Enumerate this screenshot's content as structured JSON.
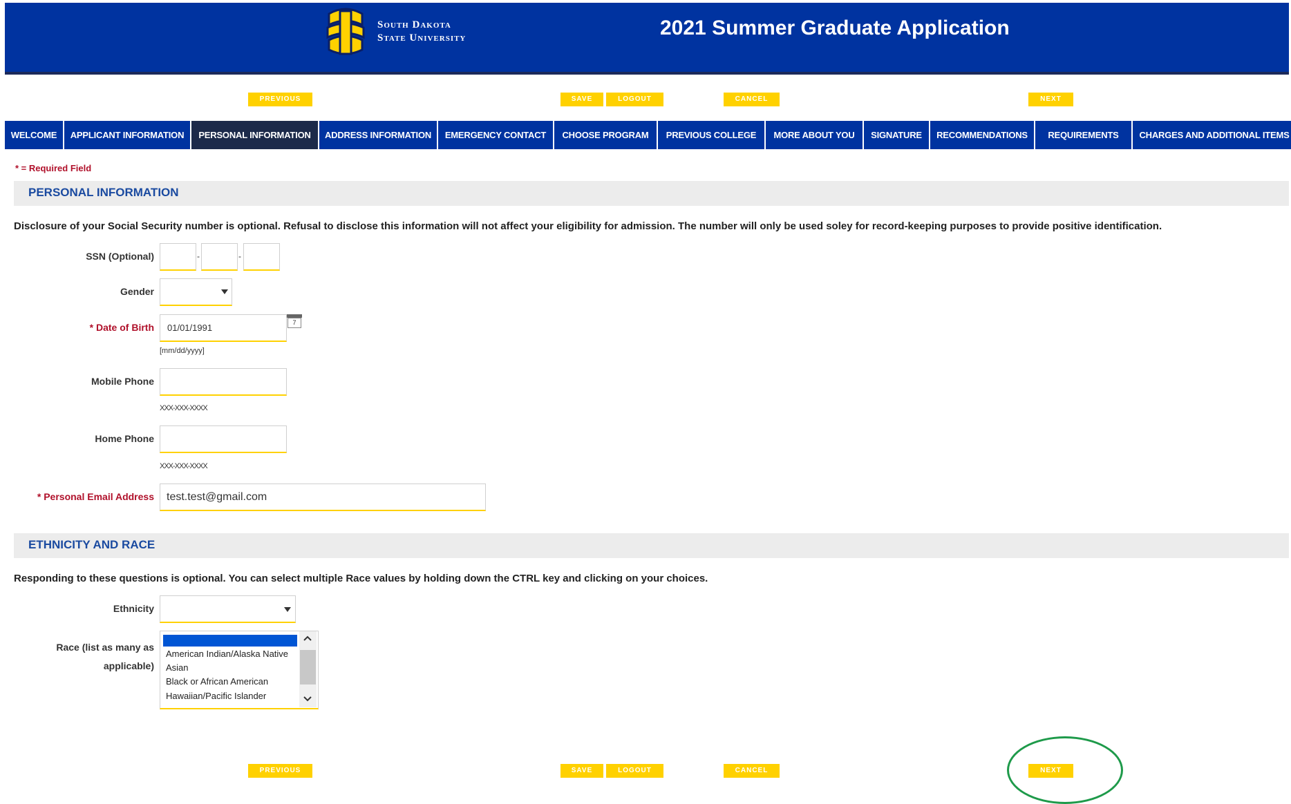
{
  "header": {
    "university_line1": "South Dakota",
    "university_line2": "State University",
    "title": "2021 Summer Graduate Application"
  },
  "actions": {
    "previous": "PREVIOUS",
    "save": "SAVE",
    "logout": "LOGOUT",
    "cancel": "CANCEL",
    "next": "NEXT"
  },
  "tabs": [
    {
      "label": "WELCOME"
    },
    {
      "label": "APPLICANT INFORMATION"
    },
    {
      "label": "PERSONAL INFORMATION"
    },
    {
      "label": "ADDRESS INFORMATION"
    },
    {
      "label": "EMERGENCY CONTACT"
    },
    {
      "label": "CHOOSE PROGRAM"
    },
    {
      "label": "PREVIOUS COLLEGE"
    },
    {
      "label": "MORE ABOUT YOU"
    },
    {
      "label": "SIGNATURE"
    },
    {
      "label": "RECOMMENDATIONS"
    },
    {
      "label": "REQUIREMENTS"
    },
    {
      "label": "CHARGES AND ADDITIONAL ITEMS"
    }
  ],
  "active_tab": "PERSONAL INFORMATION",
  "required_note": "* = Required Field",
  "personal": {
    "section_title": "PERSONAL INFORMATION",
    "disclosure": "Disclosure of your Social Security number is optional.  Refusal to disclose this information will not affect your eligibility for admission.  The number will only be used soley for record-keeping purposes to provide positive identification.",
    "ssn_label": "SSN (Optional)",
    "ssn_dash": "-",
    "gender_label": "Gender",
    "gender_value": "",
    "dob_label": "Date of Birth",
    "dob_value": "01/01/1991",
    "dob_hint": "[mm/dd/yyyy]",
    "calendar_day": "7",
    "mobile_label": "Mobile Phone",
    "mobile_hint": "XXX-XXX-XXXX",
    "home_label": "Home Phone",
    "home_hint": "XXX-XXX-XXXX",
    "email_label": "Personal Email Address",
    "email_value": "test.test@gmail.com",
    "required_mark": "*"
  },
  "ethnicity": {
    "section_title": "ETHNICITY AND RACE",
    "note": "Responding to these questions is optional.  You can select multiple Race values by holding down the CTRL key and clicking on your choices.",
    "ethnicity_label": "Ethnicity",
    "ethnicity_value": "",
    "race_label_line1": "Race (list as many as",
    "race_label_line2": "applicable)",
    "race_options": [
      "American Indian/Alaska Native",
      "Asian",
      "Black or African American",
      "Hawaiian/Pacific Islander"
    ]
  },
  "colors": {
    "brand_blue": "#0033a0",
    "active_tab": "#1c2a4a",
    "yellow": "#ffd100",
    "required_red": "#b0102a",
    "highlight_circle": "#1e9a4a"
  }
}
